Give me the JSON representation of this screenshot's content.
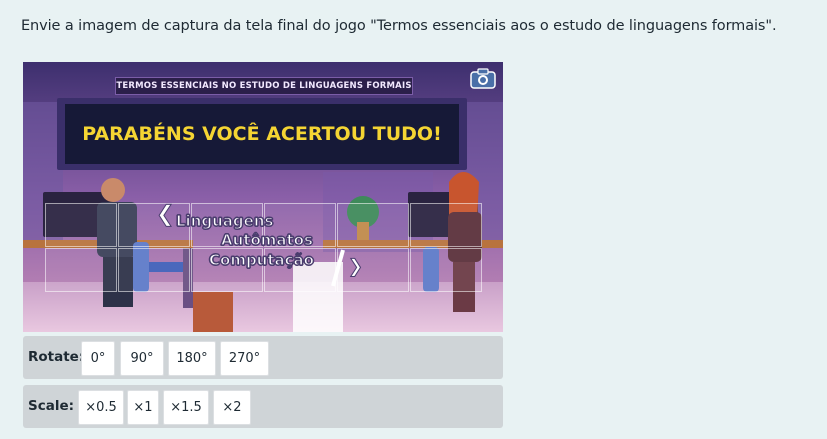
{
  "prompt": "Envie a imagem de captura da tela final do jogo \"Termos essenciais aos o estudo de linguagens formais\".",
  "game": {
    "subtitle": "TERMOS ESSENCIAIS NO ESTUDO DE LINGUAGENS FORMAIS",
    "headline": "PARABÉNS VOCÊ ACERTOU TUDO!",
    "words": [
      "Linguagens",
      "Autômatos",
      "Computação"
    ],
    "prev_glyph": "❮",
    "next_glyph": "❯",
    "camera_icon": "camera-icon",
    "colors": {
      "headline": "#f5d533",
      "banner_bg": "#161937"
    }
  },
  "rotate": {
    "label": "Rotate:",
    "options": [
      "0°",
      "90°",
      "180°",
      "270°"
    ]
  },
  "scale": {
    "label": "Scale:",
    "options": [
      "×0.5",
      "×1",
      "×1.5",
      "×2"
    ]
  }
}
